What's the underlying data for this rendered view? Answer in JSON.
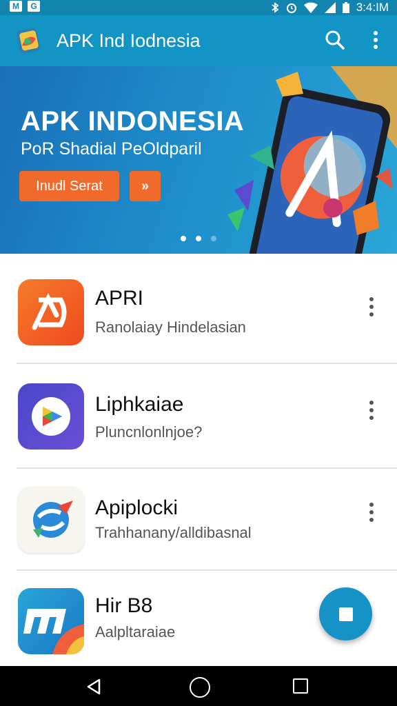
{
  "status_bar": {
    "left_icons": [
      "M",
      "G"
    ],
    "time": "3:4:IM",
    "right_icons": [
      "bluetooth-icon",
      "alarm-icon",
      "wifi-icon",
      "signal-icon",
      "battery-icon"
    ]
  },
  "app_bar": {
    "title": "APK Ind Iodnesia",
    "actions": [
      "search-icon",
      "more-vert-icon"
    ]
  },
  "banner": {
    "title": "APK INDONESIA",
    "subtitle": "PoR Shadial PeOldparil",
    "primary_button": "Inudl Serat",
    "secondary_button": "»",
    "page_indicator": {
      "count": 3,
      "active": 1
    }
  },
  "apps": [
    {
      "name": "APRI",
      "subtitle": "Ranolaiay Hindelasian"
    },
    {
      "name": "Liphkaiae",
      "subtitle": "Pluncnlonlnjoe?"
    },
    {
      "name": "Apiplocki",
      "subtitle": "Trahhanany/alldibasnal"
    },
    {
      "name": "Hir B8",
      "subtitle": "Aalpltaraiae"
    }
  ],
  "fab": {
    "icon": "stop-square-icon"
  },
  "nav_bar": {
    "buttons": [
      "back-icon",
      "home-icon",
      "recents-icon"
    ]
  },
  "colors": {
    "app_bar": "#1294c4",
    "accent_orange": "#f06a2c",
    "fab": "#1593c6"
  }
}
